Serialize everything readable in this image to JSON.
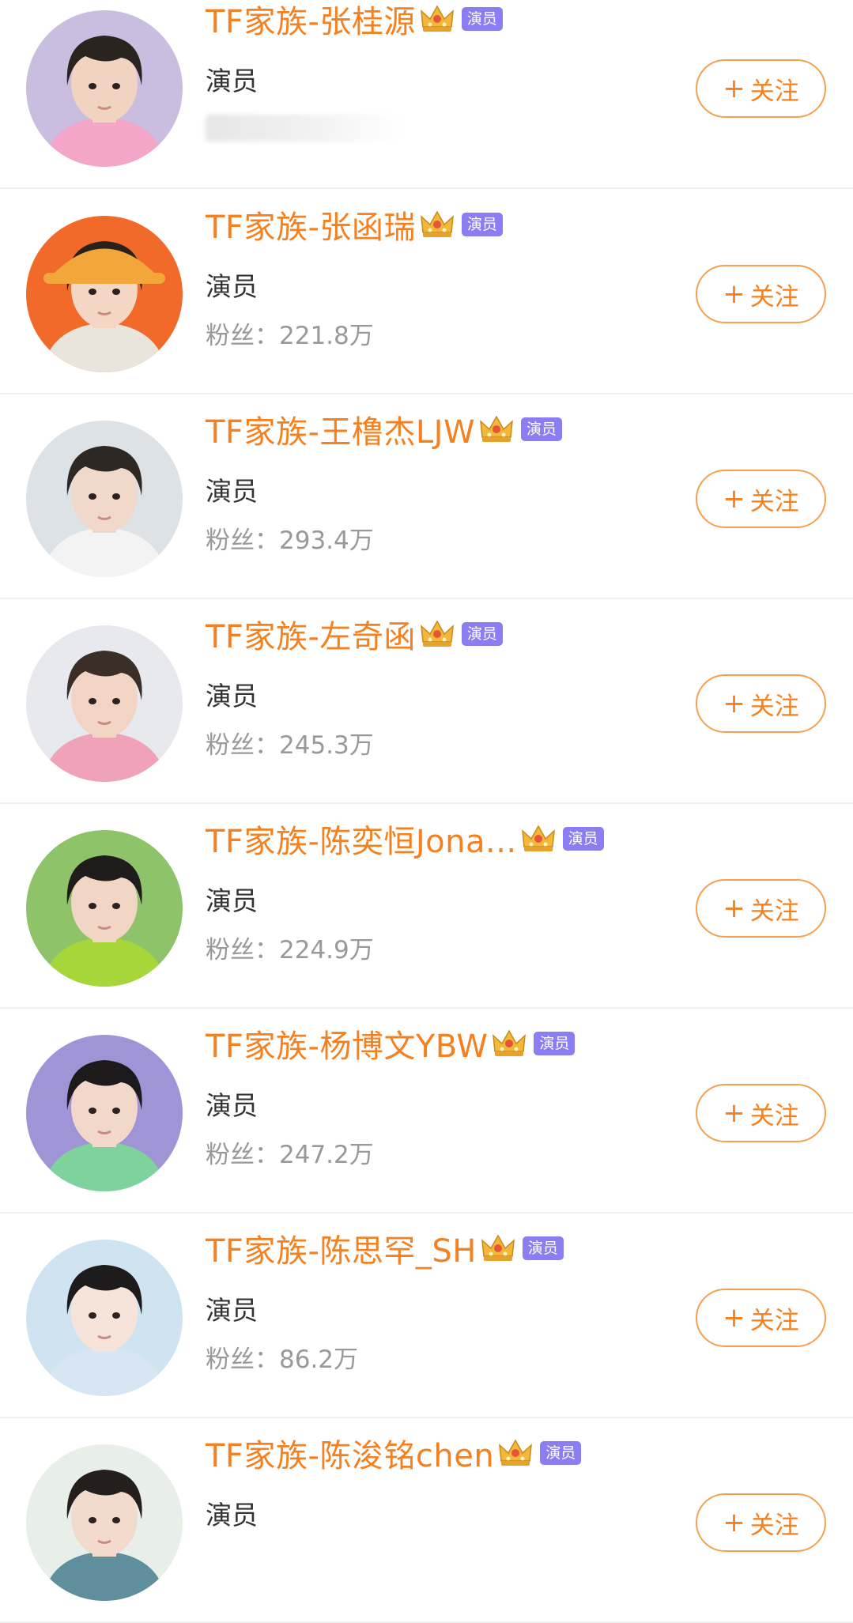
{
  "accounts": [
    {
      "name": "TF家族-张桂源",
      "badge": "演员",
      "role": "演员",
      "fans": "",
      "avatar": {
        "bg": "#c9bde0",
        "hair": "#2a2420",
        "skin": "#f1d3c2",
        "shirt": "#f4a6c8"
      }
    },
    {
      "name": "TF家族-张函瑞",
      "badge": "演员",
      "role": "演员",
      "fans": "粉丝：221.8万",
      "avatar": {
        "bg": "#f26a2a",
        "hair": "#2a211c",
        "skin": "#f3d6c3",
        "shirt": "#e9e4dc",
        "hat": "#f3a63a"
      }
    },
    {
      "name": "TF家族-王橹杰LJW",
      "badge": "演员",
      "role": "演员",
      "fans": "粉丝：293.4万",
      "avatar": {
        "bg": "#dde2e6",
        "hair": "#2e2825",
        "skin": "#f0d8cb",
        "shirt": "#f3f3f3"
      }
    },
    {
      "name": "TF家族-左奇函",
      "badge": "演员",
      "role": "演员",
      "fans": "粉丝：245.3万",
      "avatar": {
        "bg": "#e8e9ee",
        "hair": "#3a2e27",
        "skin": "#f2d4c4",
        "shirt": "#f0a3b8"
      }
    },
    {
      "name": "TF家族-陈奕恒Jona...",
      "badge": "演员",
      "role": "演员",
      "fans": "粉丝：224.9万",
      "avatar": {
        "bg": "#8fc36a",
        "hair": "#1f1c1b",
        "skin": "#f1d6c6",
        "shirt": "#a6d63a"
      }
    },
    {
      "name": "TF家族-杨博文YBW",
      "badge": "演员",
      "role": "演员",
      "fans": "粉丝：247.2万",
      "avatar": {
        "bg": "#9f95d6",
        "hair": "#1d1a1c",
        "skin": "#f2d8cb",
        "shirt": "#7ed29b"
      }
    },
    {
      "name": "TF家族-陈思罕_SH",
      "badge": "演员",
      "role": "演员",
      "fans": "粉丝：86.2万",
      "avatar": {
        "bg": "#cfe4f0",
        "hair": "#1e1b1c",
        "skin": "#f6e3d9",
        "shirt": "#d7e6f2"
      }
    },
    {
      "name": "TF家族-陈浚铭chen",
      "badge": "演员",
      "role": "演员",
      "fans": "",
      "avatar": {
        "bg": "#e7efe8",
        "hair": "#241f1d",
        "skin": "#f2dbcd",
        "shirt": "#5f8f9d"
      }
    }
  ],
  "follow_label": "关注",
  "plus_icon": "+",
  "colors": {
    "name": "#f5801f",
    "badge": "#8b7df2",
    "follow_border": "#f5a050",
    "fans": "#999999"
  }
}
